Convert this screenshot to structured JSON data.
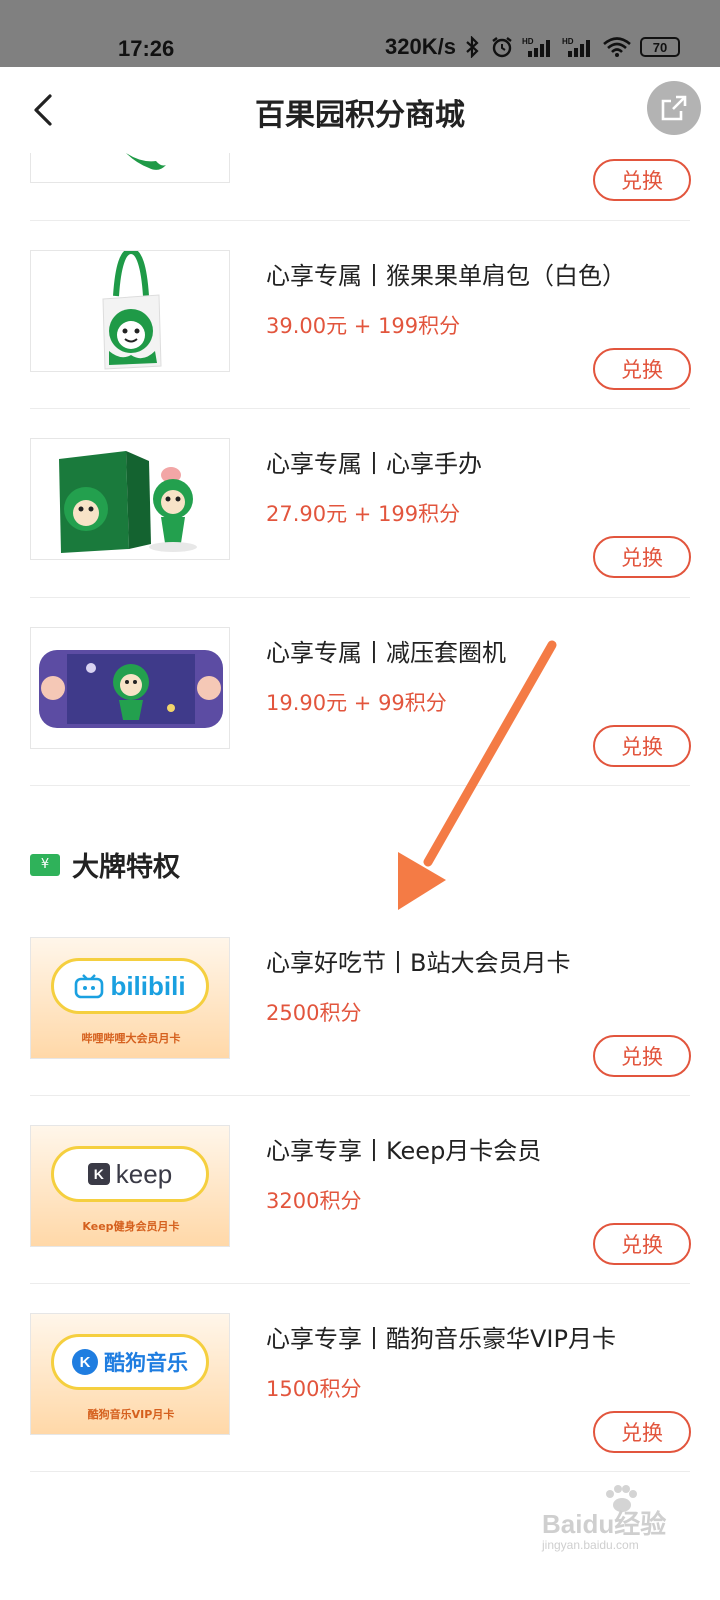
{
  "status_bar": {
    "time": "17:26",
    "speed": "320K/s",
    "battery": "70",
    "icons": [
      "bluetooth-icon",
      "alarm-icon",
      "hd-signal-icon",
      "hd-signal-icon",
      "wifi-icon",
      "battery-icon"
    ]
  },
  "header": {
    "title": "百果园积分商城",
    "back_icon": "chevron-left-icon",
    "share_icon": "share-external-icon"
  },
  "products": [
    {
      "title": "心享专属丨猴果果单肩包（白色）",
      "price": "39.00元 + 199积分",
      "button": "兑换",
      "image": "tote-bag-image"
    },
    {
      "title": "心享专属丨心享手办",
      "price": "27.90元 + 199积分",
      "button": "兑换",
      "image": "figure-box-image"
    },
    {
      "title": "心享专属丨减压套圈机",
      "price": "19.90元 + 99积分",
      "button": "兑换",
      "image": "ring-toss-game-image"
    }
  ],
  "partial_top": {
    "button": "兑换"
  },
  "section": {
    "title": "大牌特权",
    "icon": "coupon-yen-icon",
    "icon_text": "¥"
  },
  "brand_items": [
    {
      "title": "心享好吃节丨B站大会员月卡",
      "price": "2500积分",
      "button": "兑换",
      "logo_text": "bilibili",
      "caption": "哔哩哔哩大会员月卡"
    },
    {
      "title": "心享专享丨Keep月卡会员",
      "price": "3200积分",
      "button": "兑换",
      "logo_text": "keep",
      "logo_badge": "K",
      "caption": "Keep健身会员月卡"
    },
    {
      "title": "心享专享丨酷狗音乐豪华VIP月卡",
      "price": "1500积分",
      "button": "兑换",
      "logo_text": "酷狗音乐",
      "logo_badge": "K",
      "caption": "酷狗音乐VIP月卡"
    }
  ],
  "watermark": {
    "text": "Baidu经验",
    "url": "jingyan.baidu.com"
  },
  "colors": {
    "accent": "#e2553d",
    "arrow": "#f47b45",
    "status_bar": "#808080",
    "green": "#2fb25a"
  }
}
